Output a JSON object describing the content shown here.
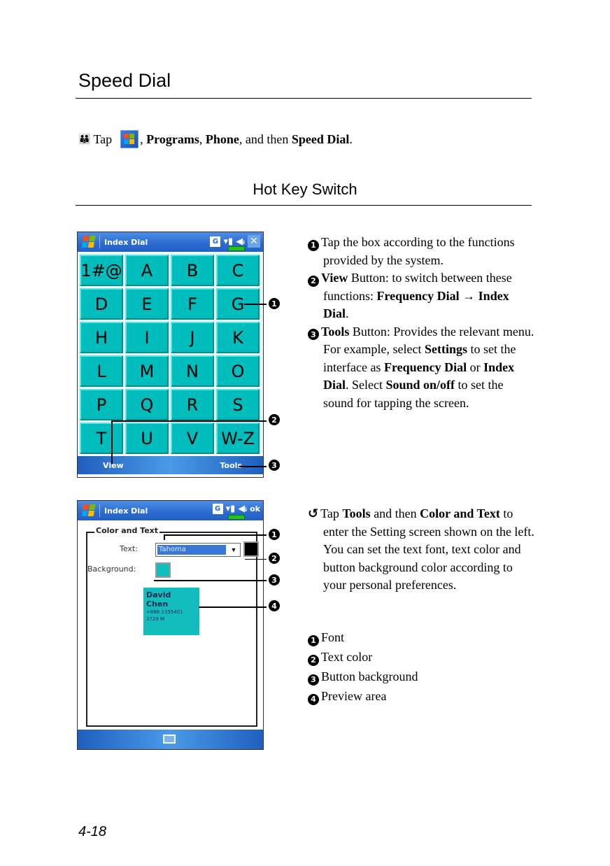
{
  "page": {
    "title": "Speed Dial",
    "intro": {
      "icon": "hand-pointer-icon",
      "prefix": "Tap",
      "start_icon": "windows-start-icon",
      "parts": [
        {
          "text": ", ",
          "bold": false
        },
        {
          "text": "Programs",
          "bold": true
        },
        {
          "text": ", ",
          "bold": false
        },
        {
          "text": "Phone",
          "bold": true
        },
        {
          "text": ", and then ",
          "bold": false
        },
        {
          "text": "Speed Dial",
          "bold": true
        },
        {
          "text": ".",
          "bold": false
        }
      ]
    },
    "section_title": "Hot Key Switch",
    "page_number": "4-18"
  },
  "screen1": {
    "app_title": "Index Dial",
    "status_icons": [
      "g-icon",
      "signal-icon",
      "speaker-icon",
      "battery-icon"
    ],
    "close_label": "✕",
    "keys": [
      "1#@",
      "A",
      "B",
      "C",
      "D",
      "E",
      "F",
      "G",
      "H",
      "I",
      "J",
      "K",
      "L",
      "M",
      "N",
      "O",
      "P",
      "Q",
      "R",
      "S",
      "T",
      "U",
      "V",
      "W-Z"
    ],
    "menu_left": "View",
    "menu_right": "Tools",
    "key_color": "#00bdbd",
    "callouts": [
      "❶",
      "❷",
      "❸"
    ]
  },
  "desc1": {
    "items": [
      {
        "num": "1",
        "parts": [
          {
            "text": "Tap the box according to the functions provided by the system.",
            "bold": false
          }
        ]
      },
      {
        "num": "2",
        "parts": [
          {
            "text": "View",
            "bold": true
          },
          {
            "text": " Button: to switch between these functions: ",
            "bold": false
          },
          {
            "text": "Frequency Dial",
            "bold": true
          },
          {
            "text": " → ",
            "bold": false
          },
          {
            "text": "Index Dial",
            "bold": true
          },
          {
            "text": ".",
            "bold": false
          }
        ]
      },
      {
        "num": "3",
        "parts": [
          {
            "text": "Tools",
            "bold": true
          },
          {
            "text": " Button: Provides the relevant menu. For example, select ",
            "bold": false
          },
          {
            "text": "Settings",
            "bold": true
          },
          {
            "text": " to set the interface as ",
            "bold": false
          },
          {
            "text": "Frequency Dial",
            "bold": true
          },
          {
            "text": " or ",
            "bold": false
          },
          {
            "text": "Index Dial",
            "bold": true
          },
          {
            "text": ". Select ",
            "bold": false
          },
          {
            "text": "Sound on/off",
            "bold": true
          },
          {
            "text": " to set the sound for tapping the screen.",
            "bold": false
          }
        ]
      }
    ]
  },
  "screen2": {
    "app_title": "Index Dial",
    "ok_label": "ok",
    "panel_title": "Color and Text",
    "text_label": "Text:",
    "font_value": "Tahoma",
    "background_label": "Background:",
    "text_color": "#000000",
    "background_color": "#11bdbd",
    "preview": {
      "name1": "David",
      "name2": "Chen",
      "line1": "+886 1355401",
      "line2": "3729 M"
    }
  },
  "desc2": {
    "icon": "arrow-return-icon",
    "parts": [
      {
        "text": "Tap ",
        "bold": false
      },
      {
        "text": "Tools",
        "bold": true
      },
      {
        "text": " and then ",
        "bold": false
      },
      {
        "text": "Color and Text",
        "bold": true
      },
      {
        "text": " to enter the Setting screen shown on the left. You can set the text font, text color and button background color according to your personal preferences.",
        "bold": false
      }
    ],
    "legend": [
      {
        "num": "1",
        "label": "Font"
      },
      {
        "num": "2",
        "label": "Text color"
      },
      {
        "num": "3",
        "label": "Button background"
      },
      {
        "num": "4",
        "label": "Preview area"
      }
    ]
  }
}
